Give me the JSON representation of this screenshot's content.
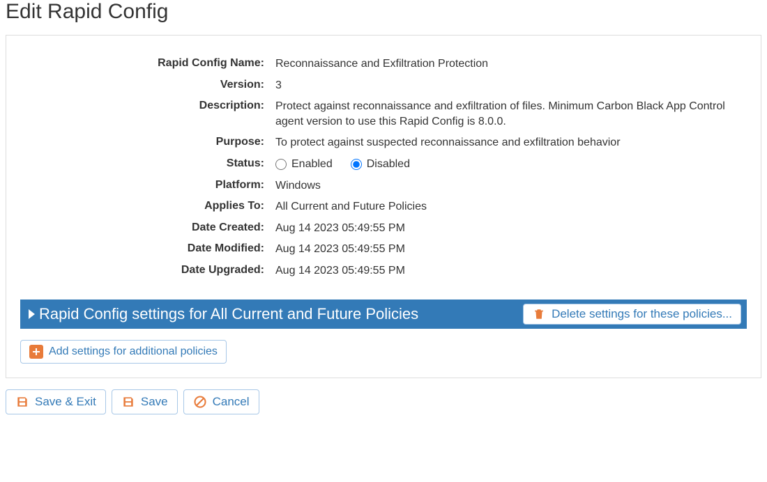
{
  "page": {
    "title": "Edit Rapid Config"
  },
  "form": {
    "labels": {
      "name": "Rapid Config Name:",
      "version": "Version:",
      "description": "Description:",
      "purpose": "Purpose:",
      "status": "Status:",
      "platform": "Platform:",
      "applies_to": "Applies To:",
      "date_created": "Date Created:",
      "date_modified": "Date Modified:",
      "date_upgraded": "Date Upgraded:"
    },
    "values": {
      "name": "Reconnaissance and Exfiltration Protection",
      "version": "3",
      "description": "Protect against reconnaissance and exfiltration of files. Minimum Carbon Black App Control agent version to use this Rapid Config is 8.0.0.",
      "purpose": "To protect against suspected reconnaissance and exfiltration behavior",
      "platform": "Windows",
      "applies_to": "All Current and Future Policies",
      "date_created": "Aug 14 2023 05:49:55 PM",
      "date_modified": "Aug 14 2023 05:49:55 PM",
      "date_upgraded": "Aug 14 2023 05:49:55 PM"
    },
    "status": {
      "enabled_label": "Enabled",
      "disabled_label": "Disabled",
      "selected": "disabled"
    }
  },
  "settings_bar": {
    "title": "Rapid Config settings for All Current and Future Policies",
    "delete_label": "Delete settings for these policies..."
  },
  "add_button": {
    "label": "Add settings for additional policies"
  },
  "footer": {
    "save_exit": "Save & Exit",
    "save": "Save",
    "cancel": "Cancel"
  },
  "colors": {
    "accent_blue": "#337ab7",
    "accent_orange": "#e87b3a"
  }
}
